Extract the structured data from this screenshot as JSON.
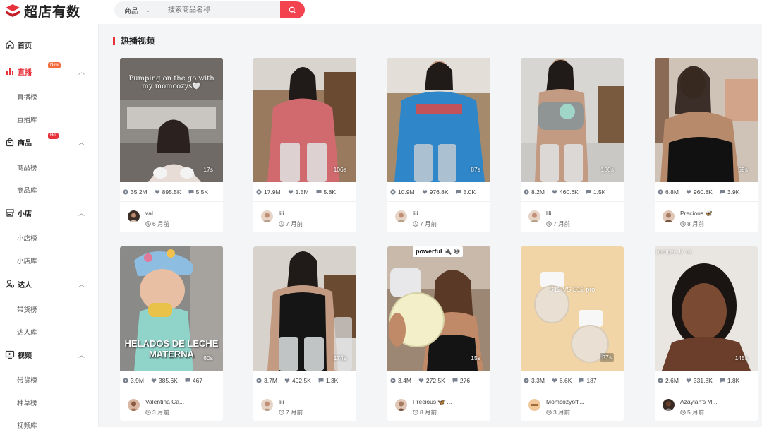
{
  "app": {
    "name": "超店有数",
    "brand_color": "#e8323b"
  },
  "search": {
    "type_label": "商品",
    "placeholder": "搜索商品名称"
  },
  "sidebar": {
    "items": [
      {
        "label": "首页",
        "icon": "home-icon"
      },
      {
        "label": "直播",
        "icon": "live-bars-icon",
        "badge": "New",
        "active": true,
        "subs": [
          "直播榜",
          "直播库"
        ]
      },
      {
        "label": "商品",
        "icon": "shopping-bag-icon",
        "badge": "Hot",
        "subs": [
          "商品榜",
          "商品库"
        ]
      },
      {
        "label": "小店",
        "icon": "store-icon",
        "subs": [
          "小店榜",
          "小店库"
        ]
      },
      {
        "label": "达人",
        "icon": "user-icon",
        "subs": [
          "带货榜",
          "达人库"
        ]
      },
      {
        "label": "视频",
        "icon": "video-icon",
        "subs": [
          "带货榜",
          "种草榜",
          "视频库"
        ]
      }
    ]
  },
  "section": {
    "title": "热播视频"
  },
  "videos": [
    {
      "duration": "17s",
      "views": "35.2M",
      "likes": "895.5K",
      "comments": "5.5K",
      "author": "val",
      "time": "6 月前",
      "overlay": "Pumping on the go with my momcozys🤍"
    },
    {
      "duration": "106s",
      "views": "17.9M",
      "likes": "1.5M",
      "comments": "5.8K",
      "author": "lili",
      "time": "7 月前"
    },
    {
      "duration": "87s",
      "views": "10.9M",
      "likes": "976.8K",
      "comments": "5.0K",
      "author": "lili",
      "time": "7 月前"
    },
    {
      "duration": "180s",
      "views": "8.2M",
      "likes": "460.6K",
      "comments": "1.5K",
      "author": "lili",
      "time": "7 月前"
    },
    {
      "duration": "59s",
      "views": "6.8M",
      "likes": "960.8K",
      "comments": "3.9K",
      "author": "Precious 🦋 ...",
      "time": "8 月前"
    },
    {
      "duration": "60s",
      "views": "3.9M",
      "likes": "385.6K",
      "comments": "467",
      "author": "Valentina Ca...",
      "time": "3 月前",
      "overlay": "HELADOS DE LECHE MATERNA"
    },
    {
      "duration": "174s",
      "views": "3.7M",
      "likes": "492.5K",
      "comments": "1.3K",
      "author": "lili",
      "time": "7 月前"
    },
    {
      "duration": "15s",
      "views": "3.4M",
      "likes": "272.5K",
      "comments": "276",
      "author": "Precious 🦋 ...",
      "time": "8 月前",
      "overlay": "powerful 🔌 😅"
    },
    {
      "duration": "87s",
      "views": "3.3M",
      "likes": "6.6K",
      "comments": "187",
      "author": "Momcozyoffi...",
      "time": "3 月前",
      "overlay": "S12 VS S12 pro"
    },
    {
      "duration": "145s",
      "views": "2.6M",
      "likes": "331.8K",
      "comments": "1.8K",
      "author": "Azaylah's M...",
      "time": "5 月前",
      "overlay": "pumped 17 oz"
    }
  ]
}
